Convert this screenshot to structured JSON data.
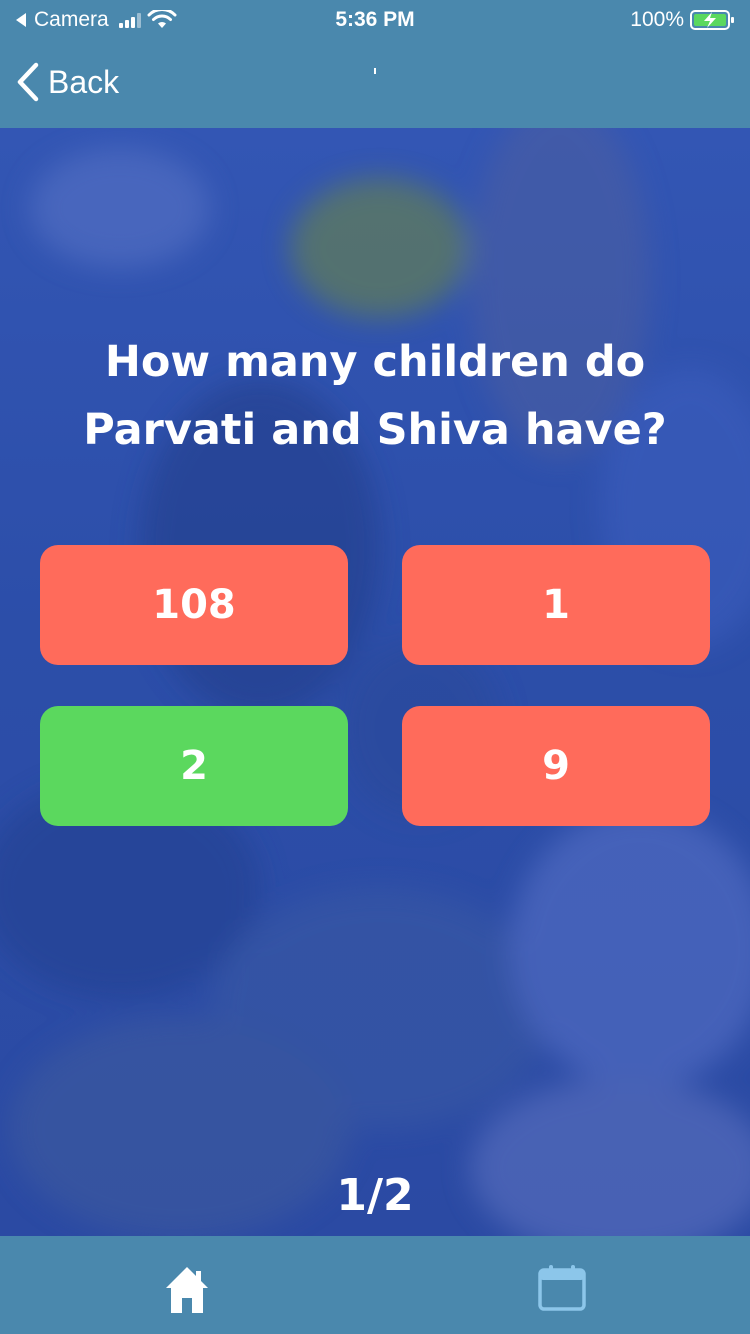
{
  "status": {
    "left_label": "Camera",
    "time": "5:36 PM",
    "battery": "100%"
  },
  "nav": {
    "back_label": "Back"
  },
  "quiz": {
    "question": "How many children do Parvati and Shiva have?",
    "answers": [
      {
        "label": "108",
        "state": "incorrect",
        "color": "#ff6b5b"
      },
      {
        "label": "1",
        "state": "incorrect",
        "color": "#ff6b5b"
      },
      {
        "label": "2",
        "state": "correct",
        "color": "#5bd85e"
      },
      {
        "label": "9",
        "state": "incorrect",
        "color": "#ff6b5b"
      }
    ],
    "progress": "1/2"
  },
  "tabs": [
    {
      "icon": "home-icon",
      "active": true
    },
    {
      "icon": "calendar-icon",
      "active": false
    }
  ],
  "colors": {
    "bar": "#4a88ad",
    "overlay": "#2f4fad",
    "incorrect": "#ff6b5b",
    "correct": "#5bd85e",
    "inactive_tab": "#8cc6ea"
  }
}
